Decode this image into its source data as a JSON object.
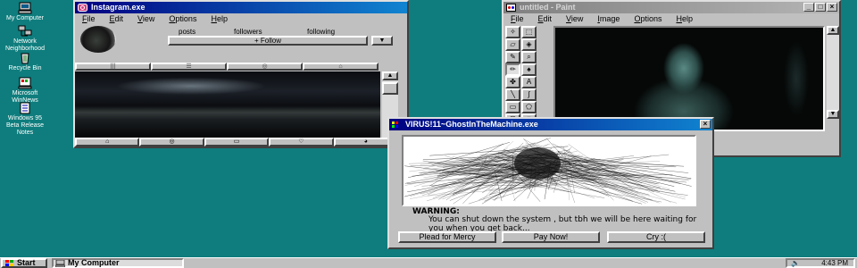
{
  "desktop": {
    "icons": [
      {
        "label": "My Computer",
        "icon": "computer-icon"
      },
      {
        "label": "Network Neighborhood",
        "icon": "network-icon"
      },
      {
        "label": "Recycle Bin",
        "icon": "recycle-bin-icon"
      },
      {
        "label": "Microsoft WinNews",
        "icon": "winnews-icon"
      },
      {
        "label": "Windows 95 Beta Release Notes",
        "icon": "notes-icon"
      }
    ]
  },
  "instagram": {
    "title": "Instagram.exe",
    "menu": [
      "File",
      "Edit",
      "View",
      "Options",
      "Help"
    ],
    "stats": {
      "posts": "posts",
      "followers": "followers",
      "following": "following"
    },
    "follow_label": "+ Follow",
    "dropdown_label": "▼",
    "tabs": [
      "|||",
      "☰",
      "◎",
      "⌂"
    ]
  },
  "paint": {
    "title": "untitled - Paint",
    "menu": [
      "File",
      "Edit",
      "View",
      "Image",
      "Options",
      "Help"
    ]
  },
  "virus": {
    "title": "VIRUS!11~GhostInTheMachine.exe",
    "warning_title": "WARNING:",
    "warning_text": "You can shut down the system , but tbh we will be here waiting for you when you get back...",
    "buttons": [
      "Plead for Mercy",
      "Pay Now!",
      "Cry :("
    ]
  },
  "taskbar": {
    "start_label": "Start",
    "task_label": "My Computer",
    "time": "4:43 PM"
  },
  "colors": {
    "desktop": "#0f7d7d",
    "title_active": "#000080",
    "window": "#c0c0c0"
  }
}
